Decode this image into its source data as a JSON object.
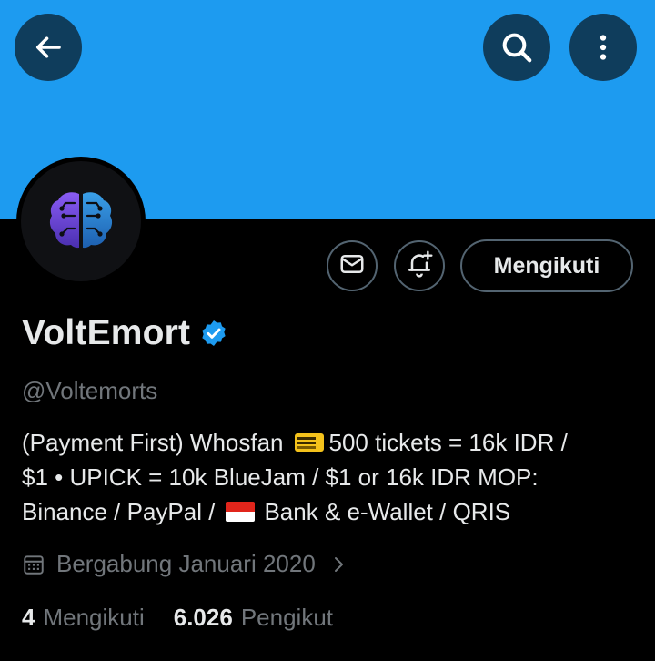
{
  "header": {
    "back_icon": "arrow-left-icon",
    "search_icon": "search-icon",
    "more_icon": "more-vertical-icon",
    "banner_color": "#1d9bf0"
  },
  "profile": {
    "avatar_icon": "brain-circuit-icon",
    "display_name": "VoltEmort",
    "verified_icon": "verified-badge-icon",
    "handle": "@Voltemorts",
    "bio": {
      "line1_a": "(Payment First) Whosfan",
      "line1_b": "500 tickets = 16k IDR /",
      "line2": "$1 • UPICK = 10k BlueJam / $1 or 16k IDR  MOP:",
      "line3_a": "Binance / PayPal /",
      "line3_b": "Bank & e-Wallet / QRIS"
    },
    "joined": "Bergabung Januari 2020"
  },
  "actions": {
    "message_icon": "envelope-icon",
    "notify_icon": "bell-plus-icon",
    "follow_label": "Mengikuti"
  },
  "stats": {
    "following_count": "4",
    "following_label": "Mengikuti",
    "followers_count": "6.026",
    "followers_label": "Pengikut"
  },
  "colors": {
    "accent": "#1d9bf0",
    "button_dark": "#0f3d5c",
    "muted_text": "#71767b",
    "text": "#e7e9ea",
    "border": "#536471"
  }
}
